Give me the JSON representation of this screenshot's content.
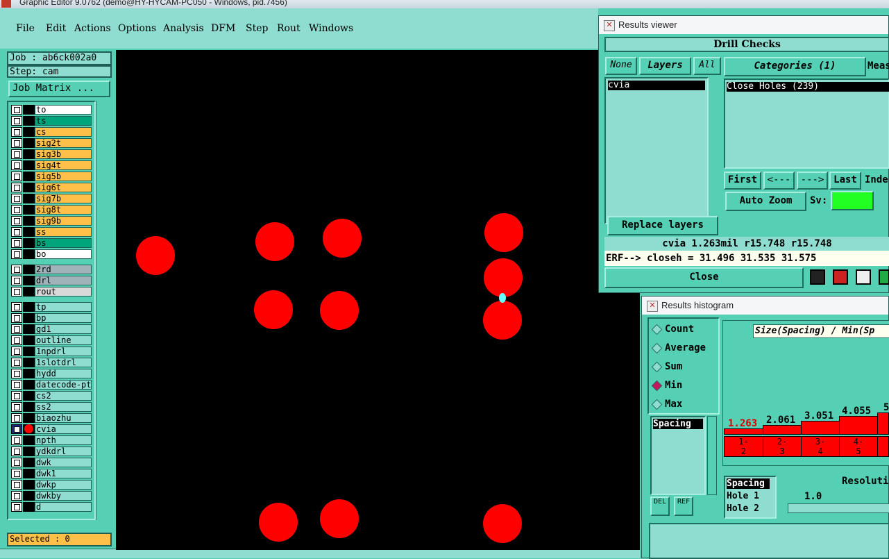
{
  "title": "Graphic Editor 9.0762 (demo@HY-HYCAM-PC050 - Windows, pid.7456)",
  "menu": [
    "File",
    "Edit",
    "Actions",
    "Options",
    "Analysis",
    "DFM",
    "Step",
    "Rout",
    "Windows"
  ],
  "job": {
    "job": "Job : ab6ck002a0",
    "step": "Step: cam",
    "matrix": "Job Matrix ..."
  },
  "layers_board": [
    {
      "name": "to",
      "color": "#ffffff"
    },
    {
      "name": "ts",
      "color": "#00a57b"
    },
    {
      "name": "cs",
      "color": "#ffc04a"
    },
    {
      "name": "sig2t",
      "color": "#ffc04a"
    },
    {
      "name": "sig3b",
      "color": "#ffc04a"
    },
    {
      "name": "sig4t",
      "color": "#ffc04a"
    },
    {
      "name": "sig5b",
      "color": "#ffc04a"
    },
    {
      "name": "sig6t",
      "color": "#ffc04a"
    },
    {
      "name": "sig7b",
      "color": "#ffc04a"
    },
    {
      "name": "sig8t",
      "color": "#ffc04a"
    },
    {
      "name": "sig9b",
      "color": "#ffc04a"
    },
    {
      "name": "ss",
      "color": "#ffc04a"
    },
    {
      "name": "bs",
      "color": "#00a57b"
    },
    {
      "name": "bo",
      "color": "#ffffff"
    }
  ],
  "layers_drill": [
    {
      "name": "2rd",
      "color": "#9fb3b8"
    },
    {
      "name": "drl",
      "color": "#9fb3b8"
    },
    {
      "name": "rout",
      "color": "#d9d9d9"
    }
  ],
  "layers_misc": [
    "tp",
    "bp",
    "gd1",
    "outline",
    "1npdrl",
    "1slotdrl",
    "hydd",
    "datecode-pte",
    "cs2",
    "ss2",
    "biaozhu",
    "cvia",
    "npth",
    "ydkdrl",
    "dwk",
    "dwk1",
    "dwkp",
    "dwkby",
    "d"
  ],
  "selected": "Selected : 0",
  "results_viewer": {
    "title": "Results viewer",
    "header": "Drill Checks",
    "none": "None",
    "layers": "Layers",
    "all": "All",
    "categories": "Categories (1)",
    "meas": "Meas",
    "layer_item": "cvia",
    "category_item": "Close Holes (239)",
    "first": "First",
    "prev": "<---",
    "next": "--->",
    "last": "Last",
    "index": "Inde",
    "auto_zoom": "Auto Zoom",
    "sv": "Sv:",
    "replace_layers": "Replace layers",
    "status": "cvia  1.263mil  r15.748  r15.748",
    "erf": "ERF--> closeh = 31.496 31.535 31.575",
    "close": "Close"
  },
  "histogram": {
    "title": "Results histogram",
    "options": [
      "Count",
      "Average",
      "Sum",
      "Min",
      "Max"
    ],
    "selected_option": "Min",
    "list_item": "Spacing",
    "chart_title": "Size(Spacing) / Min(Sp",
    "bar_values": [
      "1.263",
      "2.061",
      "3.051",
      "4.055",
      "5"
    ],
    "bins": [
      "1-\n2",
      "2-\n3",
      "3-\n4",
      "4-\n5"
    ],
    "del": "DEL",
    "ref": "REF",
    "list2": [
      "Spacing",
      "Hole 1",
      "Hole 2"
    ],
    "resolution": "Resoluti",
    "res_value": "1.0"
  },
  "colors": {
    "pad": "#ff0000",
    "panel": "#56d0b4",
    "canvas": "#000000"
  }
}
